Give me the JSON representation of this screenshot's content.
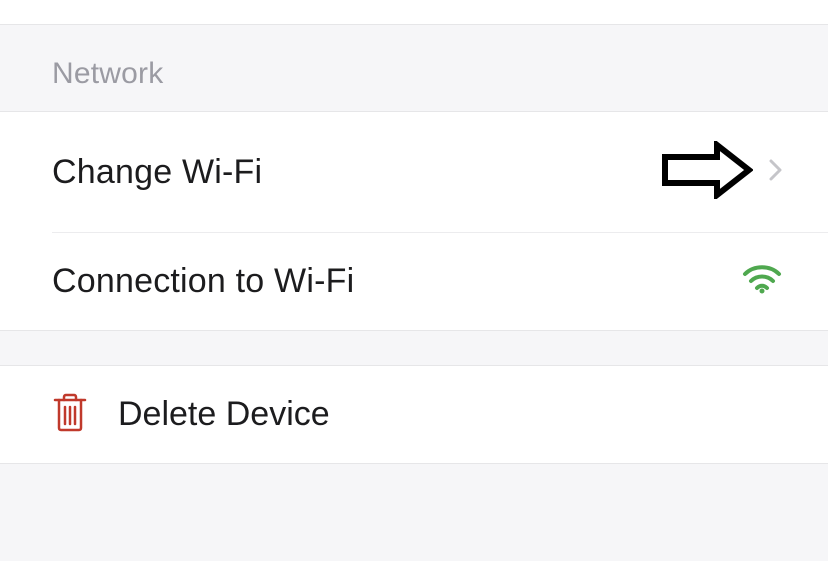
{
  "section": {
    "title": "Network"
  },
  "rows": {
    "change_wifi": "Change Wi-Fi",
    "connection": "Connection to Wi-Fi"
  },
  "delete": {
    "label": "Delete Device"
  }
}
